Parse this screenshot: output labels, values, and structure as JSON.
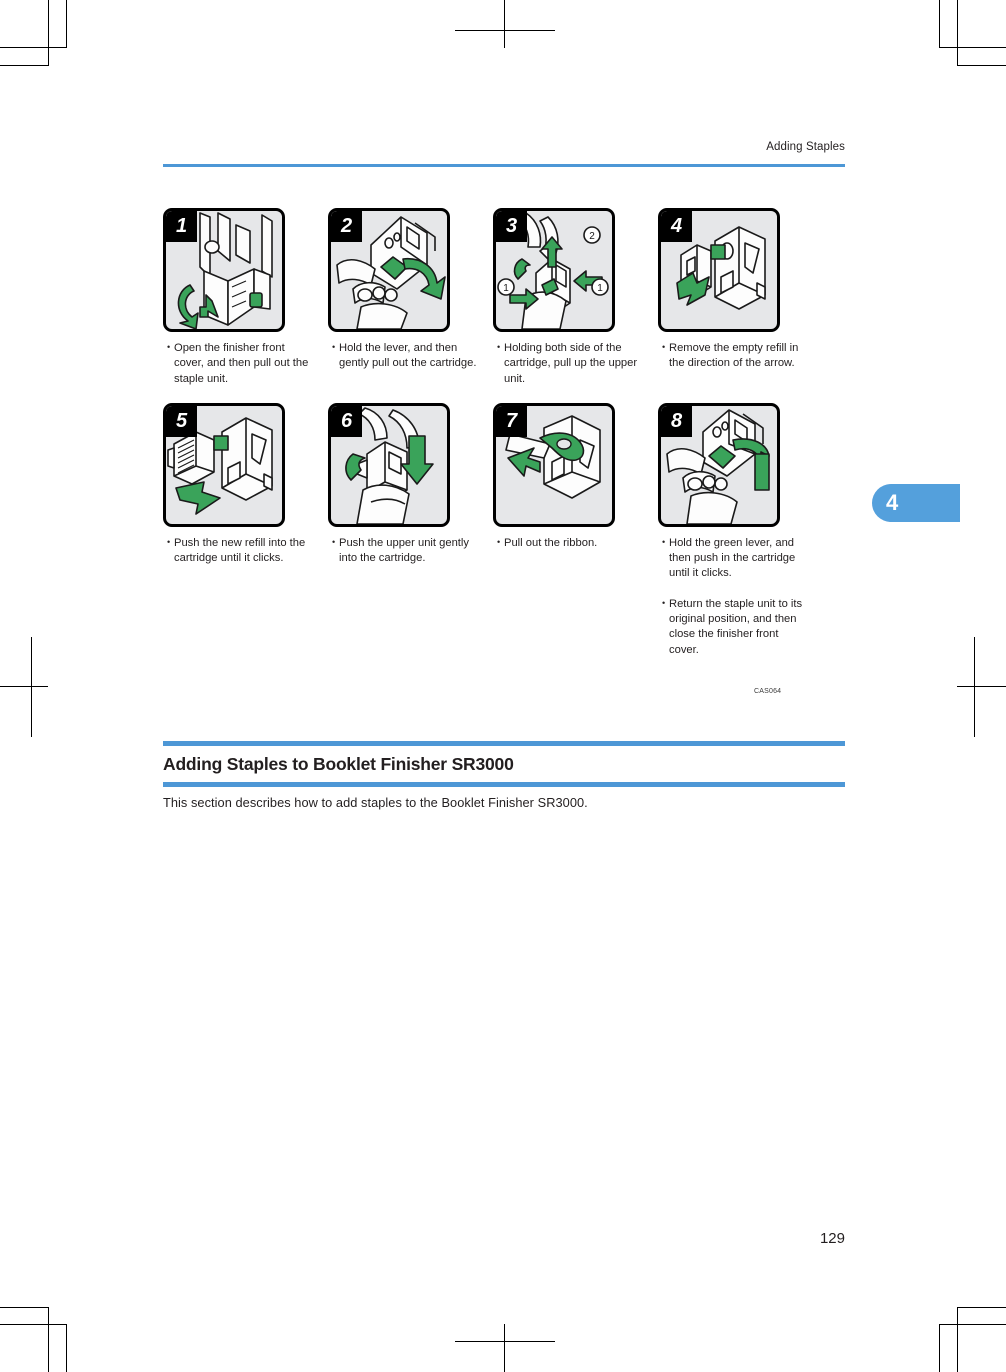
{
  "header": {
    "running_title": "Adding Staples"
  },
  "chapter_tab": {
    "number": "4"
  },
  "steps": [
    {
      "number": "1",
      "bullets": [
        "Open the finisher front cover, and then pull out the staple unit."
      ]
    },
    {
      "number": "2",
      "bullets": [
        "Hold the lever, and then gently pull out the cartridge."
      ]
    },
    {
      "number": "3",
      "bullets": [
        "Holding both side of the cartridge, pull up the upper unit."
      ],
      "callouts": [
        "①",
        "②",
        "①"
      ]
    },
    {
      "number": "4",
      "bullets": [
        "Remove the empty refill in the direction of the arrow."
      ]
    },
    {
      "number": "5",
      "bullets": [
        "Push the new refill into the cartridge until it clicks."
      ]
    },
    {
      "number": "6",
      "bullets": [
        "Push the upper unit gently into the cartridge."
      ]
    },
    {
      "number": "7",
      "bullets": [
        "Pull out the ribbon."
      ]
    },
    {
      "number": "8",
      "bullets": [
        "Hold the green lever, and then push in the cartridge until it clicks.",
        "Return the staple unit to its original position, and then close the finisher front cover."
      ]
    }
  ],
  "bullet_glyph": "・",
  "figure_code": "CAS064",
  "section": {
    "heading": "Adding Staples to Booklet Finisher SR3000",
    "body": "This section describes how to add staples to the Booklet Finisher SR3000."
  },
  "page_number": "129",
  "colors": {
    "accent_blue": "#4d97d6",
    "tab_blue": "#54a0dc",
    "illustration_green": "#3aa35a",
    "panel_background": "#e6e7e9",
    "text": "#231f20"
  }
}
